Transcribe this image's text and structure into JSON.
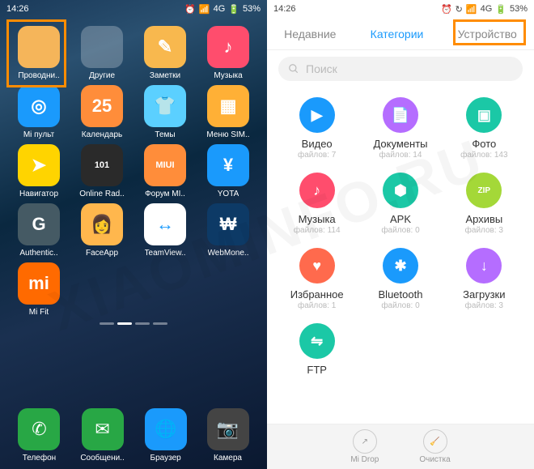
{
  "status": {
    "time": "14:26",
    "network": "4G",
    "battery": "53%"
  },
  "home": {
    "apps": [
      {
        "id": "file-explorer",
        "label": "Проводни..",
        "bg": "#f5b55a",
        "kind": "folder"
      },
      {
        "id": "other-folder",
        "label": "Другие",
        "bg": "rgba(255,255,255,.25)",
        "kind": "folder-multi"
      },
      {
        "id": "notes",
        "label": "Заметки",
        "bg": "#f8b84e",
        "glyph": "✎"
      },
      {
        "id": "music",
        "label": "Музыка",
        "bg": "#ff4d6d",
        "glyph": "♪"
      },
      {
        "id": "mi-remote",
        "label": "Mi пульт",
        "bg": "#1a9afc",
        "glyph": "◎"
      },
      {
        "id": "calendar",
        "label": "Календарь",
        "bg": "#ff8d3a",
        "glyph": "25"
      },
      {
        "id": "themes",
        "label": "Темы",
        "bg": "#5bd0ff",
        "glyph": "👕"
      },
      {
        "id": "sim-menu",
        "label": "Меню SIM..",
        "bg": "#ffb036",
        "glyph": "▦"
      },
      {
        "id": "navigator",
        "label": "Навигатор",
        "bg": "#ffd400",
        "glyph": "➤"
      },
      {
        "id": "online-radio",
        "label": "Online Rad..",
        "bg": "#2a2a2a",
        "glyph": "101"
      },
      {
        "id": "miui-forum",
        "label": "Форум MI..",
        "bg": "#ff8d3a",
        "glyph": "MIUI"
      },
      {
        "id": "yota",
        "label": "YOTA",
        "bg": "#1a9afc",
        "glyph": "¥"
      },
      {
        "id": "authenticator",
        "label": "Authentic..",
        "bg": "#455a64",
        "glyph": "G"
      },
      {
        "id": "faceapp",
        "label": "FaceApp",
        "bg": "#ffb74d",
        "glyph": "👩"
      },
      {
        "id": "teamviewer",
        "label": "TeamView..",
        "bg": "#fff",
        "glyph": "↔",
        "fg": "#1a9afc"
      },
      {
        "id": "webmoney",
        "label": "WebMone..",
        "bg": "#0d3a66",
        "glyph": "₩"
      },
      {
        "id": "mi-fit",
        "label": "Mi Fit",
        "bg": "#ff6a00",
        "glyph": "mi"
      }
    ],
    "dock": [
      {
        "id": "phone",
        "label": "Телефон",
        "bg": "#28a745",
        "glyph": "✆"
      },
      {
        "id": "messages",
        "label": "Сообщени..",
        "bg": "#28a745",
        "glyph": "✉"
      },
      {
        "id": "browser",
        "label": "Браузер",
        "bg": "#1a9afc",
        "glyph": "🌐"
      },
      {
        "id": "camera",
        "label": "Камера",
        "bg": "#444",
        "glyph": "📷"
      }
    ]
  },
  "filemgr": {
    "tabs": {
      "recent": "Недавние",
      "categories": "Категории",
      "device": "Устройство"
    },
    "search_placeholder": "Поиск",
    "files_prefix": "файлов: ",
    "categories": [
      {
        "id": "video",
        "label": "Видео",
        "count": 7,
        "bg": "#1a9afc",
        "glyph": "▶"
      },
      {
        "id": "documents",
        "label": "Документы",
        "count": 14,
        "bg": "#b56dff",
        "glyph": "📄"
      },
      {
        "id": "photo",
        "label": "Фото",
        "count": 143,
        "bg": "#1bc8a6",
        "glyph": "▣"
      },
      {
        "id": "music",
        "label": "Музыка",
        "count": 114,
        "bg": "#ff4d6d",
        "glyph": "♪"
      },
      {
        "id": "apk",
        "label": "APK",
        "count": 0,
        "bg": "#1bc8a6",
        "glyph": "⬢"
      },
      {
        "id": "archives",
        "label": "Архивы",
        "count": 3,
        "bg": "#a4d838",
        "glyph": "ZIP"
      },
      {
        "id": "favorites",
        "label": "Избранное",
        "count": 1,
        "bg": "#ff6a4d",
        "glyph": "♥"
      },
      {
        "id": "bluetooth",
        "label": "Bluetooth",
        "count": 0,
        "bg": "#1a9afc",
        "glyph": "✱"
      },
      {
        "id": "downloads",
        "label": "Загрузки",
        "count": 3,
        "bg": "#b56dff",
        "glyph": "↓"
      },
      {
        "id": "ftp",
        "label": "FTP",
        "count": null,
        "bg": "#1bc8a6",
        "glyph": "⇋"
      }
    ],
    "bottom": {
      "midrop": "Mi Drop",
      "cleanup": "Очистка"
    }
  },
  "watermark": "XIAOMINFO.RU"
}
